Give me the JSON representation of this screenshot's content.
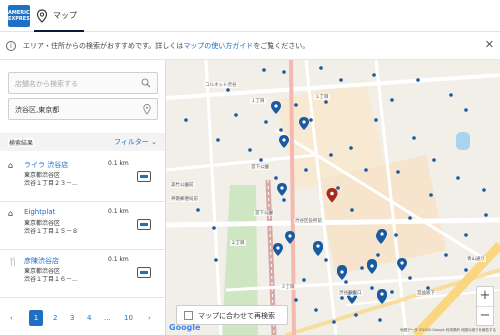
{
  "header": {
    "brand_text": "AMERICAN EXPRESS",
    "tab_label": "マップ"
  },
  "notice": {
    "text_before": "エリア・住所からの検索がおすすめです。詳しくは",
    "link": "マップの使い方ガイド",
    "text_after": "をご覧ください。"
  },
  "search": {
    "placeholder": "店舗名から検索する"
  },
  "location": {
    "value": "渋谷区,東京都"
  },
  "results": {
    "label": "検索結果",
    "filter_label": "フィルター"
  },
  "stores": [
    {
      "icon": "building-icon",
      "name": "ライラ 渋谷店",
      "address1": "東京都渋谷区",
      "address2": "渋谷１丁目２３－...",
      "distance": "0.1 km"
    },
    {
      "icon": "building-icon",
      "name": "Eightplat",
      "address1": "東京都渋谷区",
      "address2": "渋谷１丁目１５－８",
      "distance": "0.1 km"
    },
    {
      "icon": "fork-knife-icon",
      "name": "彦陳渋谷店",
      "address1": "東京都渋谷区",
      "address2": "渋谷１丁目１６－...",
      "distance": "0.1 km"
    }
  ],
  "pager": {
    "pages": [
      "1",
      "2",
      "3",
      "4",
      "...",
      "10"
    ],
    "current": "1"
  },
  "map": {
    "research_label": "マップに合わせて再検索",
    "zoom_in": "+",
    "zoom_out": "−",
    "google": "Google",
    "attribution": "地図データ ©2020 Google  利用規約  地図の誤りを報告する",
    "street_labels": [
      "コルネット渋谷",
      "１丁目",
      "１丁目",
      "宮下公園",
      "美竹公園前",
      "神南郵便局前",
      "宮下公園",
      "２丁目",
      "渋谷区役所前",
      "３丁目",
      "宮益坂下",
      "渋谷駅東口",
      "青山通り"
    ]
  },
  "colors": {
    "accent": "#1f6fc5",
    "marker": "#1a5aa0",
    "selected_marker": "#a52a1f",
    "map_bg": "#f2efe9",
    "park": "#cfe6c3",
    "water": "#aad3ef",
    "road_major": "#f9d680"
  }
}
